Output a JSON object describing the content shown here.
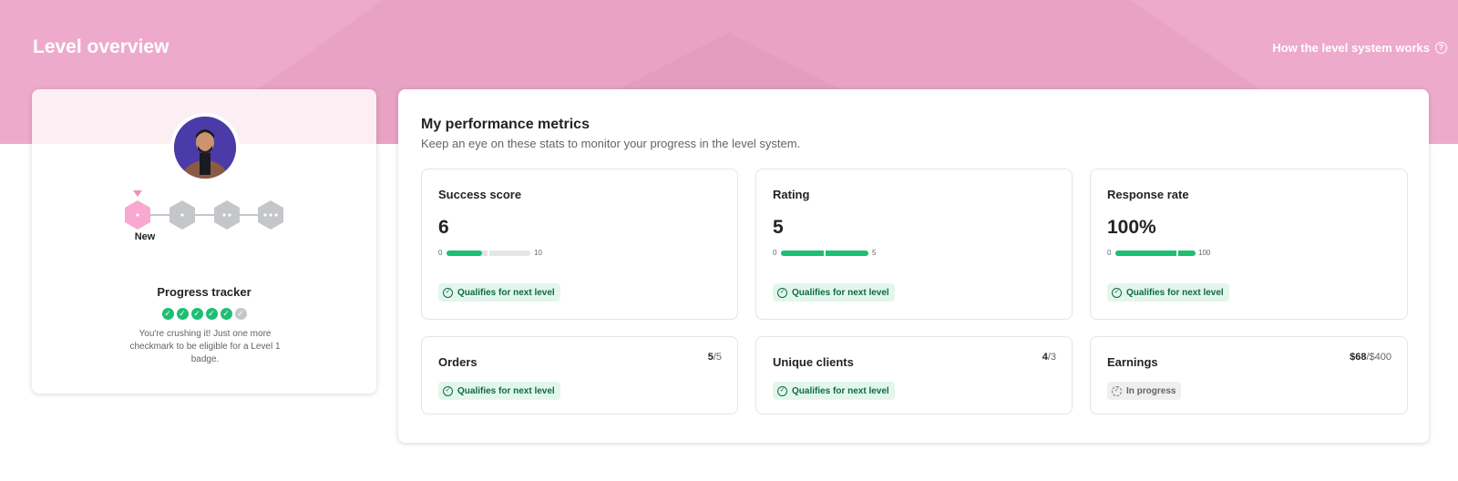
{
  "header": {
    "title": "Level overview",
    "help_link": "How the level system works",
    "help_icon": "question-circle-icon"
  },
  "profile": {
    "avatar": "seller-avatar",
    "current_level": "New",
    "levels": [
      "New",
      "Level 1",
      "Level 2",
      "Level 3"
    ],
    "tracker_title": "Progress tracker",
    "checks_completed": 5,
    "checks_total": 6,
    "message": "You're crushing it! Just one more checkmark to be eligible for a Level 1 badge."
  },
  "metrics": {
    "title": "My performance metrics",
    "subtitle": "Keep an eye on these stats to monitor your progress in the level system.",
    "cards": [
      {
        "title": "Success score",
        "value": "6",
        "min": "0",
        "max": "10",
        "fill": 0.42,
        "target": 0.5,
        "status": "Qualifies for next level"
      },
      {
        "title": "Rating",
        "value": "5",
        "min": "0",
        "max": "5",
        "fill": 1.0,
        "target": 0.5,
        "status": "Qualifies for next level"
      },
      {
        "title": "Response rate",
        "value": "100%",
        "min": "0",
        "max": "100",
        "fill": 1.0,
        "target": 0.77,
        "status": "Qualifies for next level"
      },
      {
        "title": "Orders",
        "current": "5",
        "required": "/5",
        "status": "Qualifies for next level"
      },
      {
        "title": "Unique clients",
        "current": "4",
        "required": "/3",
        "status": "Qualifies for next level"
      },
      {
        "title": "Earnings",
        "current": "$68",
        "required": "/$400",
        "status": "In progress"
      }
    ]
  },
  "colors": {
    "banner": "#eeaacb",
    "accent_green": "#1dbf73",
    "level_pink": "#f9a8d0",
    "level_gray": "#c5c6c9"
  }
}
